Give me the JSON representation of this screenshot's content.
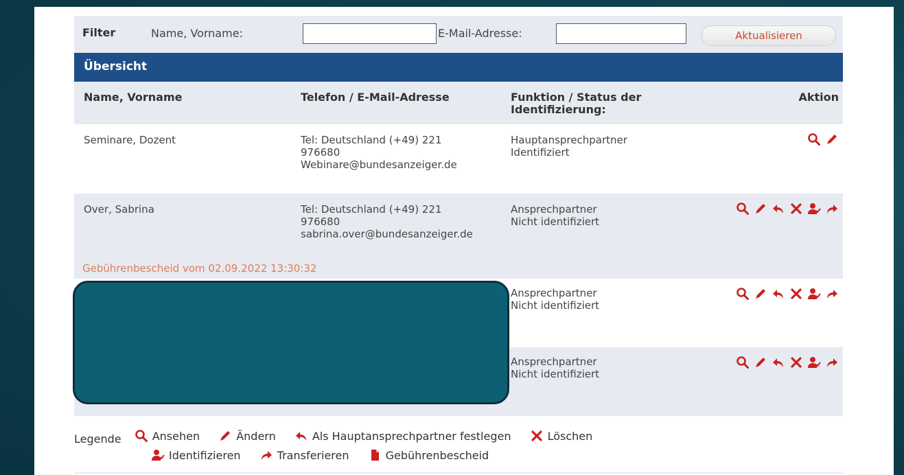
{
  "filter": {
    "title": "Filter",
    "name_label": "Name, Vorname:",
    "name_value": "",
    "email_label": "E-Mail-Adresse:",
    "email_value": "",
    "update_button": "Aktualisieren"
  },
  "overview": {
    "title": "Übersicht"
  },
  "columns": {
    "name": "Name, Vorname",
    "contact": "Telefon / E-Mail-Adresse",
    "function_line1": "Funktion / Status der",
    "function_line2": "Identifizierung:",
    "action": "Aktion"
  },
  "rows": [
    {
      "name": "Seminare, Dozent",
      "tel_line1": "Tel: Deutschland (+49) 221",
      "tel_line2": "976680",
      "email": "Webinare@bundesanzeiger.de",
      "function": "Hauptansprechpartner",
      "status": "Identifiziert"
    },
    {
      "name": "Over, Sabrina",
      "tel_line1": "Tel: Deutschland (+49) 221",
      "tel_line2": "976680",
      "email": "sabrina.over@bundesanzeiger.de",
      "function": "Ansprechpartner",
      "status": "Nicht identifiziert",
      "fee_notice": "Gebührenbescheid vom 02.09.2022 13:30:32"
    },
    {
      "function": "Ansprechpartner",
      "status": "Nicht identifiziert"
    },
    {
      "function": "Ansprechpartner",
      "status": "Nicht identifiziert"
    }
  ],
  "legend": {
    "title": "Legende",
    "view": "Ansehen",
    "edit": "Ändern",
    "set_main": "Als Hauptansprechpartner festlegen",
    "delete": "Löschen",
    "identify": "Identifizieren",
    "transfer": "Transferieren",
    "fee": "Gebührenbescheid"
  },
  "colors": {
    "header_blue": "#1e4f88",
    "icon_red": "#cc1f1f",
    "fee_orange": "#e07b55",
    "row_alt": "#e7ebf1"
  }
}
